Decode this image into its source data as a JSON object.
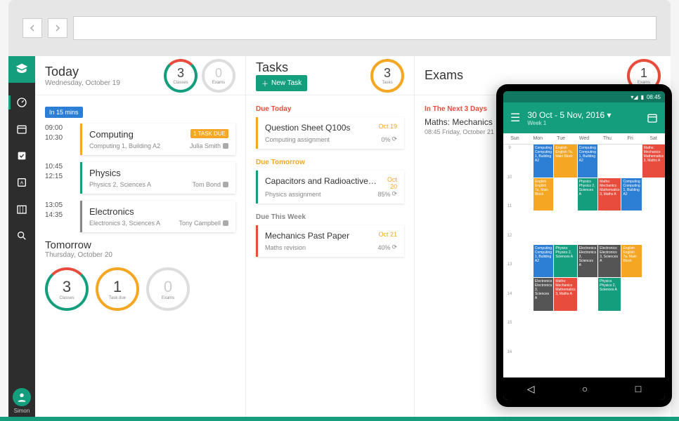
{
  "sidebar": {
    "user": "Simon"
  },
  "today": {
    "title": "Today",
    "date": "Wednesday, October 19",
    "classes_count": "3",
    "classes_label": "Classes",
    "exams_count": "0",
    "exams_label": "Exams",
    "reminder": "In 15 mins",
    "classes": [
      {
        "start": "09:00",
        "end": "10:30",
        "name": "Computing",
        "room": "Computing 1, Building A2",
        "teacher": "Julia Smith",
        "border": "#f5a623",
        "badge": "1 TASK DUE"
      },
      {
        "start": "10:45",
        "end": "12:15",
        "name": "Physics",
        "room": "Physics 2, Sciences A",
        "teacher": "Tom Bond",
        "border": "#159e7e",
        "badge": ""
      },
      {
        "start": "13:05",
        "end": "14:35",
        "name": "Electronics",
        "room": "Electronics 3, Sciences A",
        "teacher": "Tony Campbell",
        "border": "#888",
        "badge": ""
      }
    ]
  },
  "tomorrow": {
    "title": "Tomorrow",
    "date": "Thursday, October 20",
    "classes_count": "3",
    "classes_label": "Classes",
    "tasks_count": "1",
    "tasks_label": "Task due",
    "exams_count": "0",
    "exams_label": "Exams"
  },
  "tasks": {
    "title": "Tasks",
    "new_task": "New Task",
    "count": "3",
    "count_label": "Tasks",
    "sections": {
      "today": {
        "label": "Due Today",
        "item": {
          "title": "Question Sheet Q100s",
          "sub": "Computing assignment",
          "date": "Oct 19",
          "pct": "0%",
          "border": "#f5a623"
        }
      },
      "tomorrow": {
        "label": "Due Tomorrow",
        "item": {
          "title": "Capacitors and Radioactive De",
          "sub": "Physics assignment",
          "date": "Oct 20",
          "pct": "85%",
          "border": "#159e7e"
        }
      },
      "week": {
        "label": "Due This Week",
        "item": {
          "title": "Mechanics Past Paper",
          "sub": "Maths revision",
          "date": "Oct 21",
          "pct": "40%",
          "border": "#e74c3c"
        }
      }
    }
  },
  "exams": {
    "title": "Exams",
    "count": "1",
    "count_label": "Exams",
    "next_label": "In The Next 3 Days",
    "item": {
      "title": "Maths: Mechanics",
      "sub": "08:45 Friday, October 21"
    }
  },
  "mobile": {
    "time": "08:45",
    "week_range": "30 Oct - 5 Nov, 2016",
    "week_label": "Week 1",
    "days": [
      "Sun",
      "Mon",
      "Tue",
      "Wed",
      "Thu",
      "Fri",
      "Sat"
    ],
    "hours": [
      "9",
      "10",
      "11",
      "12",
      "13",
      "14",
      "15",
      "16"
    ],
    "events": [
      {
        "r": 1,
        "c": 2,
        "text": "Computing Computing 1, Building A2",
        "bg": "#2d7fd6"
      },
      {
        "r": 1,
        "c": 3,
        "text": "English English 7a, Main Block",
        "bg": "#f5a623"
      },
      {
        "r": 1,
        "c": 4,
        "text": "Computing Computing 1, Building A2",
        "bg": "#2d7fd6"
      },
      {
        "r": 1,
        "c": 7,
        "text": "Maths: Mechanics Mathematics 3, Maths A",
        "bg": "#e74c3c"
      },
      {
        "r": 2,
        "c": 2,
        "text": "English English 7a, Main Block",
        "bg": "#f5a623"
      },
      {
        "r": 2,
        "c": 4,
        "text": "Physics Physics 2, Sciences A",
        "bg": "#159e7e"
      },
      {
        "r": 2,
        "c": 5,
        "text": "Maths: Mechanics Mathematics 3, Maths A",
        "bg": "#e74c3c"
      },
      {
        "r": 2,
        "c": 6,
        "text": "Computing Computing 1, Building A2",
        "bg": "#2d7fd6"
      },
      {
        "r": 4,
        "c": 2,
        "text": "Computing Computing 1, Building A2",
        "bg": "#2d7fd6"
      },
      {
        "r": 4,
        "c": 3,
        "text": "Physics Physics 2, Sciences A",
        "bg": "#159e7e"
      },
      {
        "r": 4,
        "c": 4,
        "text": "Electronics Electronics 3, Sciences A",
        "bg": "#555"
      },
      {
        "r": 4,
        "c": 5,
        "text": "Electronics Electronics 3, Sciences A",
        "bg": "#555"
      },
      {
        "r": 4,
        "c": 6,
        "text": "English English 7a, Main Block",
        "bg": "#f5a623"
      },
      {
        "r": 5,
        "c": 2,
        "text": "Electronics Electronics 3, Sciences A",
        "bg": "#555"
      },
      {
        "r": 5,
        "c": 3,
        "text": "Maths: Mechanics Mathematics 3, Maths A",
        "bg": "#e74c3c"
      },
      {
        "r": 5,
        "c": 5,
        "text": "Physics Physics 2, Sciences A",
        "bg": "#159e7e"
      }
    ]
  }
}
